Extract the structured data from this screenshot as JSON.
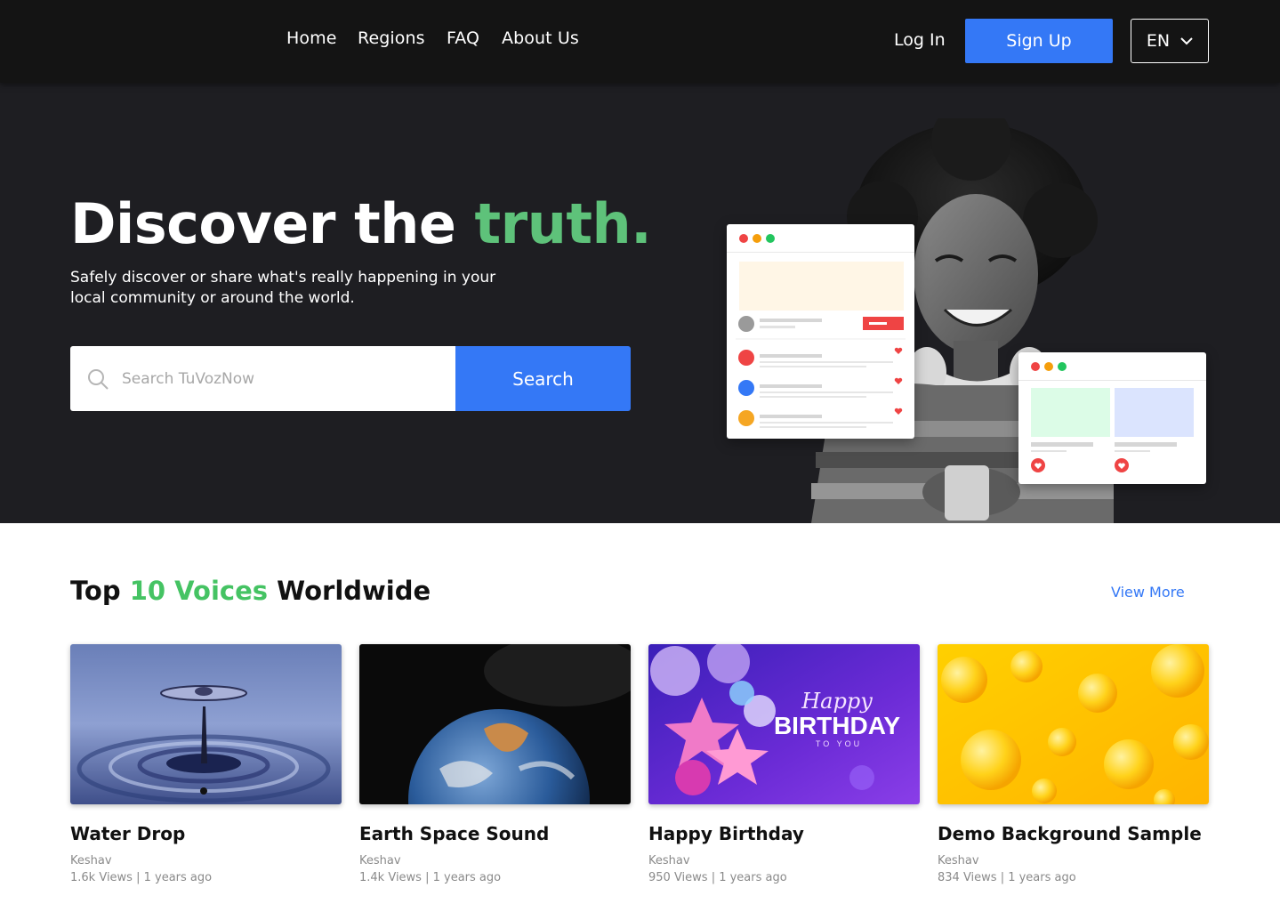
{
  "nav": {
    "links": [
      "Home",
      "Regions",
      "FAQ",
      "About Us"
    ],
    "login": "Log In",
    "signup": "Sign Up",
    "language": "EN"
  },
  "hero": {
    "title_main": "Discover the",
    "title_accent": "truth.",
    "subtitle": "Safely discover or share what's really happening in your local community or around the world.",
    "search_placeholder": "Search TuVozNow",
    "search_button": "Search"
  },
  "colors": {
    "accent_green": "#5ec27a",
    "brand_blue": "#3478f6",
    "nav_bg": "#141414",
    "hero_bg": "#1e1e22"
  },
  "section": {
    "title_pre": "Top",
    "title_accent": "10 Voices",
    "title_post": "Worldwide",
    "view_more": "View More"
  },
  "cards": [
    {
      "title": "Water Drop",
      "author": "Keshav",
      "meta": "1.6k Views | 1 years ago",
      "image": "water-drop-image"
    },
    {
      "title": "Earth Space Sound",
      "author": "Keshav",
      "meta": "1.4k Views | 1 years ago",
      "image": "earth-image"
    },
    {
      "title": "Happy Birthday",
      "author": "Keshav",
      "meta": "950 Views | 1 years ago",
      "image": "birthday-balloons-image"
    },
    {
      "title": "Demo Background Sample",
      "author": "Keshav",
      "meta": "834 Views | 1 years ago",
      "image": "yellow-bubbles-image"
    }
  ],
  "birthday_art": {
    "line1": "Happy",
    "line2": "BIRTHDAY",
    "line3": "TO YOU"
  }
}
